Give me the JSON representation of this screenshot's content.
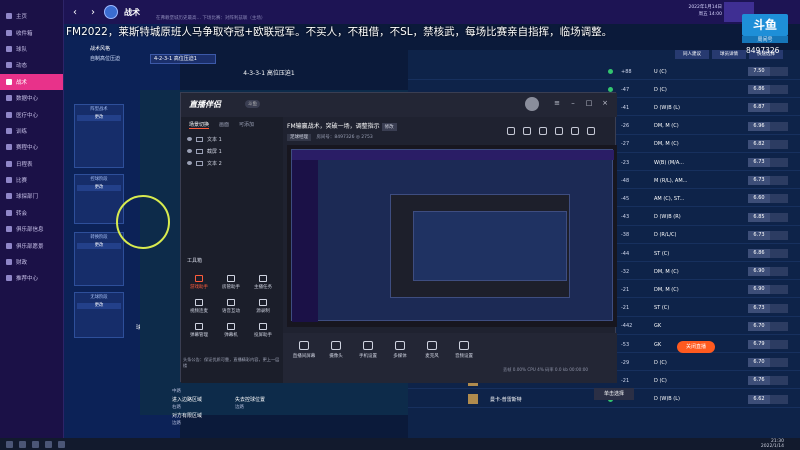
{
  "fm": {
    "window_title": "战术",
    "subtitle": "在弗赖堡城历史最高…  下场比赛：对阵利兹联（主场）",
    "date_line1": "2022年1月14日",
    "date_line2": "周五  14:00",
    "sidebar": [
      {
        "label": "主页"
      },
      {
        "label": "收件箱"
      },
      {
        "label": "球队"
      },
      {
        "label": "动态"
      },
      {
        "label": "战术",
        "active": true
      },
      {
        "label": "数据中心"
      },
      {
        "label": "医疗中心"
      },
      {
        "label": "训练"
      },
      {
        "label": "赛程中心"
      },
      {
        "label": "日程表"
      },
      {
        "label": "比赛"
      },
      {
        "label": "球探部门"
      },
      {
        "label": "转会"
      },
      {
        "label": "俱乐部信息"
      },
      {
        "label": "俱乐部愿景"
      },
      {
        "label": "财政"
      },
      {
        "label": "推荐中心"
      }
    ],
    "tactic": {
      "section": "战术风格",
      "style_name": "自制高位压迫",
      "formation_select": "4-2-3-1 高位压迫1",
      "formation_label": "4-3-3-1 高位压迫1",
      "cards": [
        {
          "text": "阵型战术",
          "btn": "更改"
        },
        {
          "text": "控球阶段",
          "btn": "更改"
        },
        {
          "text": "转换阶段",
          "btn": "更改"
        },
        {
          "text": "无球阶段",
          "btn": "更改"
        }
      ],
      "list_item": "球队多数",
      "notes": [
        "中路",
        "进入边路区域",
        "右路",
        "对方有限区域",
        "边路"
      ],
      "notes_right": [
        "失去控球位置",
        "边路"
      ]
    },
    "squad": {
      "top_buttons": [
        "同人建议",
        "球员详情",
        "快速选择"
      ],
      "rows": [
        {
          "pos": "U (C)",
          "num": "+88",
          "stat": "7.50"
        },
        {
          "pos": "D (C)",
          "num": "-47",
          "stat": "6.86"
        },
        {
          "pos": "D (W)B (L)",
          "num": "-41",
          "stat": "6.87"
        },
        {
          "pos": "DM, M (C)",
          "num": "-26",
          "stat": "6.96"
        },
        {
          "pos": "DM, M (C)",
          "num": "-27",
          "stat": "6.82"
        },
        {
          "pos": "W(B) (M/A...",
          "num": "-23",
          "stat": "6.73"
        },
        {
          "pos": "M (R/L), AM...",
          "num": "-48",
          "stat": "6.73"
        },
        {
          "pos": "AM (C), ST...",
          "num": "-45",
          "stat": "6.60"
        },
        {
          "pos": "D (W)B (R)",
          "num": "-43",
          "stat": "6.85"
        },
        {
          "pos": "D (R/L/C)",
          "num": "-38",
          "stat": "6.73"
        },
        {
          "pos": "ST (C)",
          "num": "-44",
          "stat": "6.86"
        },
        {
          "pos": "DM, M (C)",
          "num": "-32",
          "stat": "6.90"
        },
        {
          "pos": "DM, M (C)",
          "num": "-21",
          "stat": "6.90"
        },
        {
          "pos": "ST (C)",
          "num": "-21",
          "stat": "6.73"
        },
        {
          "pos": "GK",
          "num": "-442",
          "stat": "6.70"
        },
        {
          "pos": "GK",
          "num": "-53",
          "stat": "6.79"
        },
        {
          "pos": "D (C)",
          "num": "-29",
          "stat": "6.70"
        },
        {
          "pos": "D (C)",
          "num": "-21",
          "stat": "6.76"
        },
        {
          "pos": "D (W)B (L)",
          "num": "-13",
          "stat": "6.62"
        }
      ],
      "names": [
        "内尔 沃默",
        "马斯纳-福达姆",
        "曼卡-普雷斯特"
      ],
      "auto_pick": "单击选择"
    }
  },
  "stream": {
    "banner": "FM2022，莱斯特城原班人马争取夺冠+欧联冠军。不买人，不租借，不SL，禁核武，每场比赛亲自指挥，临场调整。",
    "logo_main": "斗鱼",
    "logo_sub": "周间号",
    "channel_id": "8497326",
    "app_name": "直播伴侣",
    "app_tag": "斗鱼",
    "scene_tabs": [
      "场景切换",
      "画面",
      "可添加"
    ],
    "scenes": [
      "文本 1",
      "截屏 1",
      "文本 2"
    ],
    "tools_title": "工具箱",
    "tools": [
      "游戏助手",
      "房管助手",
      "主播任务",
      "视频连麦",
      "语音互动",
      "源录制",
      "弹幕管理",
      "弹幕机",
      "投屏助手"
    ],
    "notice": "头条公告：保证优质可靠，直播精彩内容，更上一层楼",
    "preview_title": "FM输赢战术，突破一场，调整指示",
    "preview_tag": "修改",
    "meta_category": "足球经理",
    "meta_room": "房间号：8497326",
    "meta_viewers": "2753",
    "controls": [
      "直播间屏幕",
      "摄像头",
      "手机设置",
      "多媒体",
      "麦克风",
      "音频设置"
    ],
    "go_live": "关闭直播",
    "stats": "丢帧 0.00%   CPU 4%   码率 0.0 kb   00:00:00"
  },
  "taskbar": {
    "time": "21:30",
    "date": "2022/1/14"
  }
}
